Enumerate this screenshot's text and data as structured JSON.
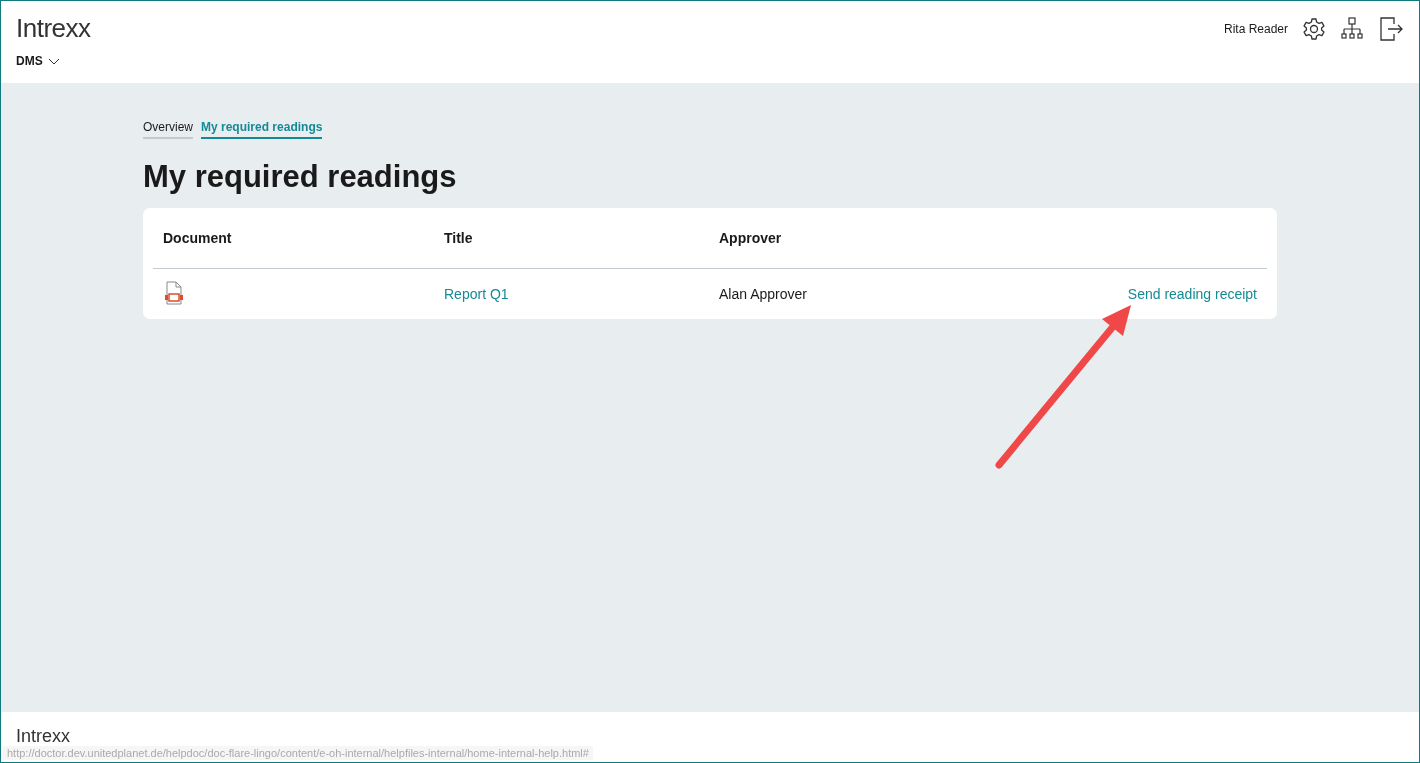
{
  "header": {
    "logo": "Intrexx",
    "app_menu": "DMS",
    "user": "Rita Reader"
  },
  "tabs": [
    {
      "label": "Overview",
      "selected": false
    },
    {
      "label": "My required readings",
      "selected": true
    }
  ],
  "page_title": "My required readings",
  "table": {
    "columns": [
      "Document",
      "Title",
      "Approver"
    ],
    "rows": [
      {
        "title": "Report Q1",
        "approver": "Alan Approver",
        "action": "Send reading receipt"
      }
    ]
  },
  "footer": {
    "logo": "Intrexx"
  },
  "status_bar": {
    "url": "http://doctor.dev.unitedplanet.de/helpdoc/doc-flare-lingo/content/e-oh-internal/helpfiles-internal/home-internal-help.html#"
  }
}
